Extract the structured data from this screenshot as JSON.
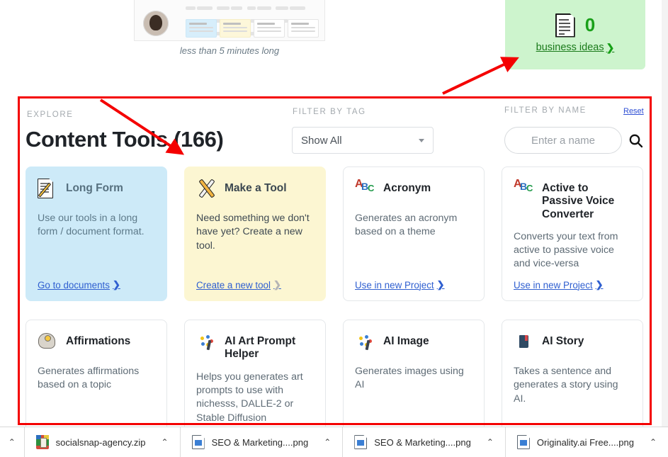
{
  "video_preview": {
    "caption": "less than 5 minutes long",
    "avatar_name": "presenter-avatar"
  },
  "business_ideas_tile": {
    "count": "0",
    "link_label": "business ideas",
    "chevron": "❯",
    "icon": "document-icon",
    "bg_color": "#cdf4cd",
    "count_color": "#1aa01a"
  },
  "explore_panel": {
    "eyebrow_explore": "EXPLORE",
    "title": "Content Tools (166)",
    "filter_by_tag_label": "FILTER BY TAG",
    "filter_by_name_label": "FILTER BY NAME",
    "reset_label": "Reset",
    "tag_select": {
      "value": "Show All",
      "options": [
        "Show All"
      ]
    },
    "name_search": {
      "value": "",
      "placeholder": "Enter a name"
    },
    "search_icon": "search-icon"
  },
  "cards": [
    {
      "title": "Long Form",
      "description": "Use our tools in a long form / document format.",
      "link": "Go to documents",
      "chevron": "❯",
      "icon": "document-pencil-icon",
      "variant": "blue"
    },
    {
      "title": "Make a Tool",
      "description": "Need something we don't have yet? Create a new tool.",
      "link": "Create a new tool",
      "chevron": "❯",
      "icon": "hammer-wrench-icon",
      "variant": "yellow"
    },
    {
      "title": "Acronym",
      "description": "Generates an acronym based on a theme",
      "link": "Use in new Project",
      "chevron": "❯",
      "icon": "abc-letters-icon",
      "variant": "plain"
    },
    {
      "title": "Active to Passive Voice Converter",
      "description": "Converts your text from active to passive voice and vice-versa",
      "link": "Use in new Project",
      "chevron": "❯",
      "icon": "abc-letters-icon",
      "variant": "plain"
    },
    {
      "title": "Affirmations",
      "description": "Generates affirmations based on a topic",
      "link": "",
      "chevron": "",
      "icon": "head-lightbulb-icon",
      "variant": "plain"
    },
    {
      "title": "AI Art Prompt Helper",
      "description": "Helps you generates art prompts to use with nichesss, DALLE-2 or Stable Diffusion",
      "link": "",
      "chevron": "",
      "icon": "paint-palette-icon",
      "variant": "plain"
    },
    {
      "title": "AI Image",
      "description": "Generates images using AI",
      "link": "",
      "chevron": "",
      "icon": "paint-palette-icon",
      "variant": "plain"
    },
    {
      "title": "AI Story",
      "description": "Takes a sentence and generates a story using AI.",
      "link": "",
      "chevron": "",
      "icon": "book-icon",
      "variant": "plain"
    }
  ],
  "downloads_bar": {
    "collapse_chevron": "⌃",
    "items": [
      {
        "name": "socialsnap-agency.zip",
        "icon": "zip-file-icon",
        "caret": "⌃"
      },
      {
        "name": "SEO & Marketing....png",
        "icon": "png-file-icon",
        "caret": "⌃"
      },
      {
        "name": "SEO & Marketing....png",
        "icon": "png-file-icon",
        "caret": "⌃"
      },
      {
        "name": "Originality.ai Free....png",
        "icon": "png-file-icon",
        "caret": "⌃"
      }
    ]
  },
  "annotations": {
    "highlight_color": "#f40000",
    "arrow_1": "arrow-pointing-to-content-tools-title",
    "arrow_2": "arrow-pointing-to-business-ideas-tile",
    "box": "red-highlight-box-around-content-tools"
  }
}
